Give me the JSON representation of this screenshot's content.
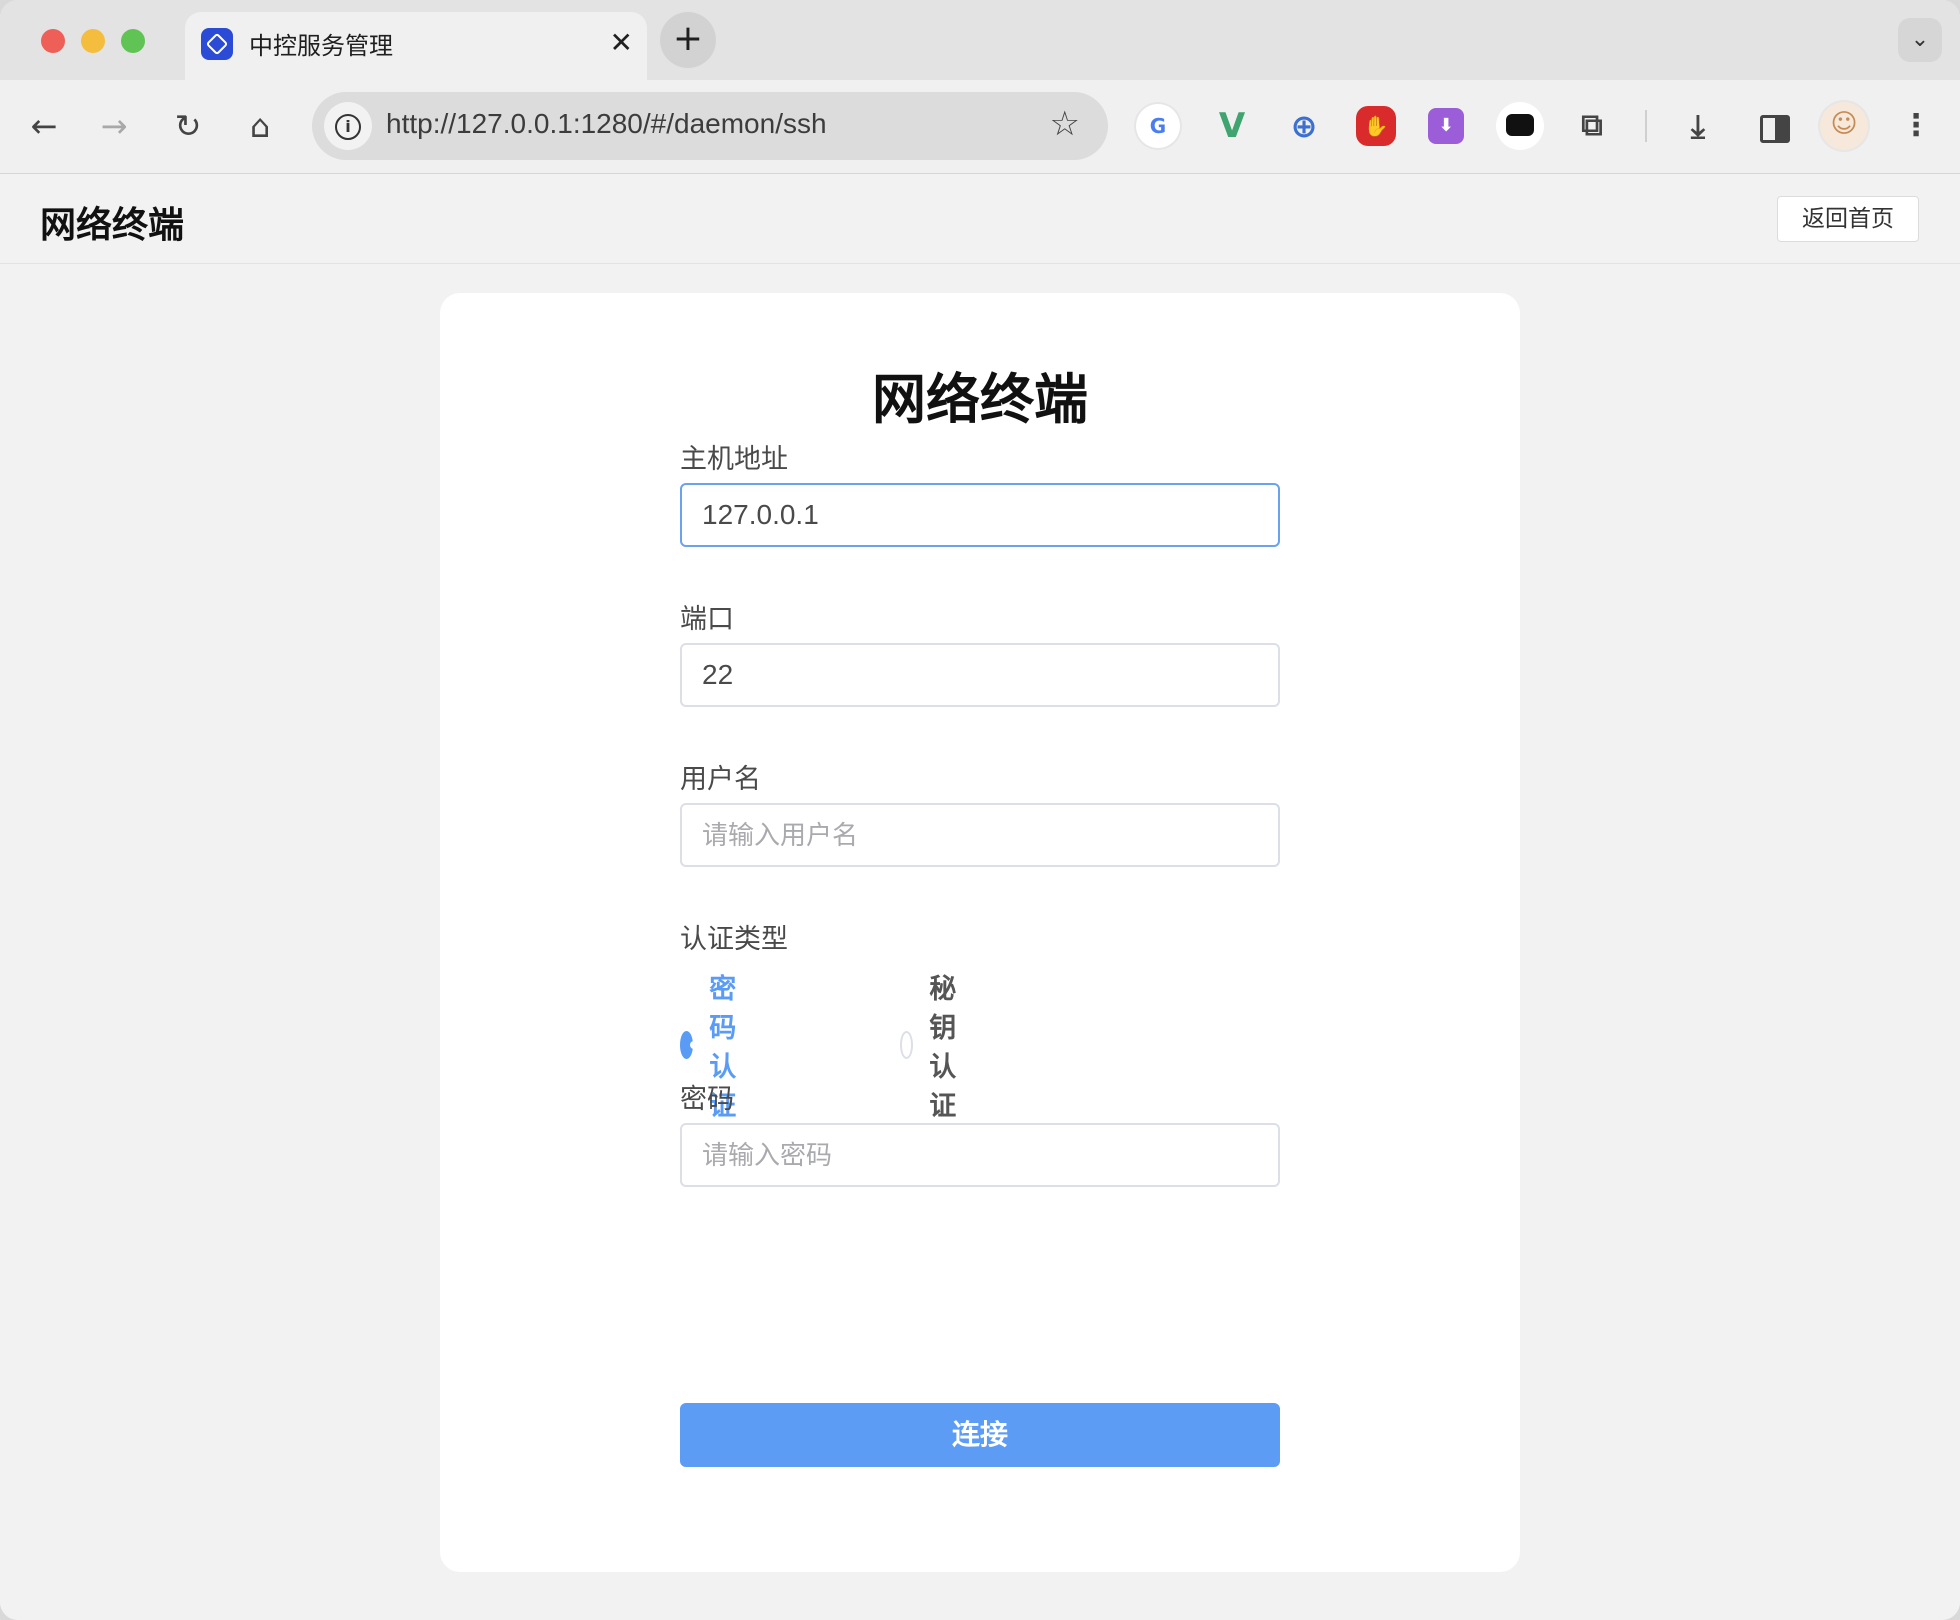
{
  "browser": {
    "tab": {
      "title": "中控服务管理",
      "close_glyph": "✕"
    },
    "new_tab_glyph": "+",
    "tab_list_glyph": "⌄",
    "nav": {
      "back": "←",
      "forward": "→",
      "reload": "↻",
      "home": "⌂"
    },
    "address": {
      "url": "http://127.0.0.1:1280/#/daemon/ssh",
      "info_glyph": "i",
      "bookmark_glyph": "☆"
    },
    "extensions": [
      {
        "name": "google-translate-icon",
        "glyph": "G"
      },
      {
        "name": "vue-devtools-icon",
        "glyph": "V"
      },
      {
        "name": "password-manager-icon",
        "glyph": "⊕"
      },
      {
        "name": "adblock-icon",
        "glyph": "✋"
      },
      {
        "name": "download-helper-icon",
        "glyph": "⬇"
      },
      {
        "name": "tampermonkey-icon",
        "glyph": ""
      },
      {
        "name": "extensions-puzzle-icon",
        "glyph": "⧉"
      },
      {
        "name": "downloads-icon",
        "glyph": "⤓"
      },
      {
        "name": "side-panel-icon",
        "glyph": ""
      },
      {
        "name": "profile-avatar",
        "glyph": "☺"
      },
      {
        "name": "more-menu-icon",
        "glyph": "⋮"
      }
    ]
  },
  "app": {
    "header_title": "网络终端",
    "home_button": "返回首页"
  },
  "form": {
    "title": "网络终端",
    "host": {
      "label": "主机地址",
      "value": "127.0.0.1"
    },
    "port": {
      "label": "端口",
      "value": "22"
    },
    "username": {
      "label": "用户名",
      "value": "",
      "placeholder": "请输入用户名"
    },
    "auth_type": {
      "label": "认证类型",
      "options": [
        {
          "label": "密码认证",
          "selected": true
        },
        {
          "label": "秘钥认证",
          "selected": false
        }
      ]
    },
    "password": {
      "label": "密码",
      "value": "",
      "placeholder": "请输入密码"
    },
    "submit_label": "连接"
  },
  "colors": {
    "accent": "#5c9cf5",
    "focus_border": "#6aa2ee",
    "page_bg": "#f2f2f2",
    "card_bg": "#ffffff"
  }
}
